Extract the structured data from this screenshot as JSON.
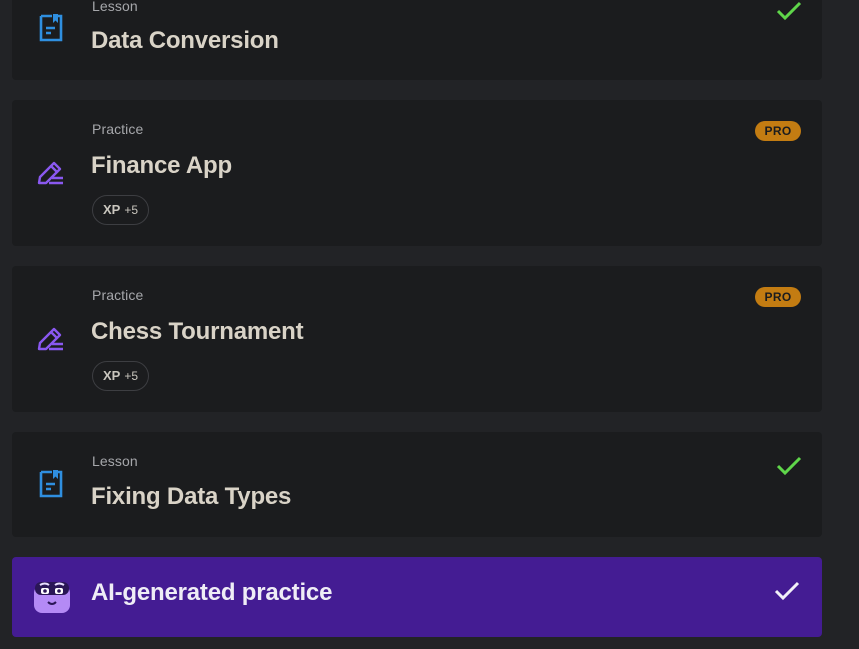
{
  "items": [
    {
      "type": "Lesson",
      "title": "Data Conversion",
      "status_icon": "check-icon"
    },
    {
      "type": "Practice",
      "title": "Finance App",
      "badge": "PRO",
      "xp_label": "XP",
      "xp_value": "+5"
    },
    {
      "type": "Practice",
      "title": "Chess Tournament",
      "badge": "PRO",
      "xp_label": "XP",
      "xp_value": "+5"
    },
    {
      "type": "Lesson",
      "title": "Fixing Data Types",
      "status_icon": "check-icon"
    }
  ],
  "ai_practice": {
    "title": "AI-generated practice",
    "status_icon": "check-icon"
  },
  "colors": {
    "background": "#222326",
    "card": "#1b1c1e",
    "lesson_icon": "#2f8fe0",
    "practice_icon": "#8a58f0",
    "check": "#5fd64a",
    "pro_badge": "#c37c12",
    "ai_card": "#441c93"
  }
}
